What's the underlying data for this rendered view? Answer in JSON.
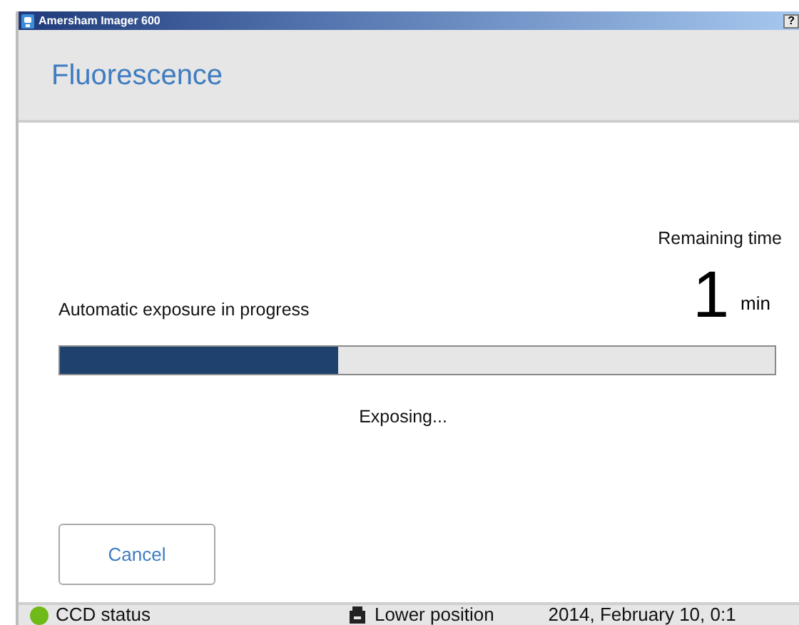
{
  "window": {
    "title": "Amersham Imager 600",
    "help_button": "?"
  },
  "header": {
    "title": "Fluorescence"
  },
  "exposure": {
    "remaining_label": "Remaining time",
    "remaining_value": "1",
    "remaining_unit": "min",
    "message": "Automatic exposure in progress",
    "level": 0.39,
    "state": "Exposing..."
  },
  "buttons": [
    "Cancel"
  ],
  "status_bar": {
    "ccd": {
      "label": "CCD status",
      "color": "#6fb919"
    },
    "position": "Lower position",
    "datetime": "2014, February 10, 0:1"
  }
}
